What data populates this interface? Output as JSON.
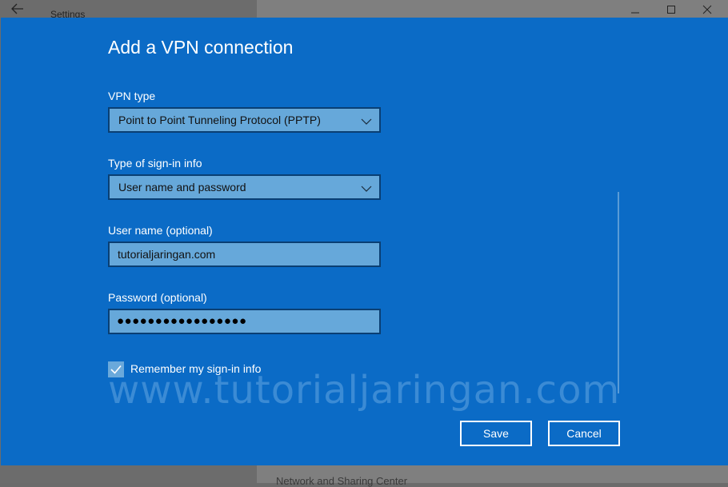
{
  "window": {
    "title": "Settings"
  },
  "dialog": {
    "heading": "Add a VPN connection",
    "vpn_type": {
      "label": "VPN type",
      "value": "Point to Point Tunneling Protocol (PPTP)"
    },
    "signin_type": {
      "label": "Type of sign-in info",
      "value": "User name and password"
    },
    "username": {
      "label": "User name (optional)",
      "value": "tutorialjaringan.com"
    },
    "password": {
      "label": "Password (optional)",
      "value": "●●●●●●●●●●●●●●●●●"
    },
    "remember": {
      "label": "Remember my sign-in info",
      "checked": true
    },
    "save_label": "Save",
    "cancel_label": "Cancel"
  },
  "watermark": "www.tutorialjaringan.com",
  "background_text": "Network and Sharing Center",
  "colors": {
    "accent": "#0b6bc6",
    "field": "#66a8da",
    "field_border": "#0a3f73"
  }
}
